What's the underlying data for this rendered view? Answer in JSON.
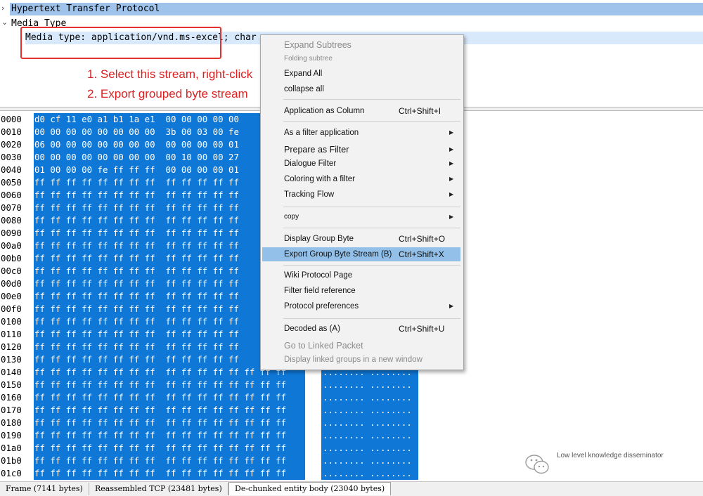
{
  "tree": {
    "http_row": "Hypertext Transfer Protocol",
    "media_row": "Media Type",
    "media_type_row": "Media type: application/vnd.ms-excel; char"
  },
  "annotations": {
    "step1": "1. Select this stream, right-click",
    "step2": "2. Export grouped byte stream"
  },
  "hex_rows": [
    {
      "offset": "0000",
      "bytes": "d0 cf 11 e0 a1 b1 1a e1  00 00 00 00 00",
      "ascii": ""
    },
    {
      "offset": "0010",
      "bytes": "00 00 00 00 00 00 00 00  3b 00 03 00 fe",
      "ascii": ""
    },
    {
      "offset": "0020",
      "bytes": "06 00 00 00 00 00 00 00  00 00 00 00 01",
      "ascii": ""
    },
    {
      "offset": "0030",
      "bytes": "00 00 00 00 00 00 00 00  00 10 00 00 27",
      "ascii": ""
    },
    {
      "offset": "0040",
      "bytes": "01 00 00 00 fe ff ff ff  00 00 00 00 01",
      "ascii": ""
    },
    {
      "offset": "0050",
      "bytes": "ff ff ff ff ff ff ff ff  ff ff ff ff ff",
      "ascii": ""
    },
    {
      "offset": "0060",
      "bytes": "ff ff ff ff ff ff ff ff  ff ff ff ff ff",
      "ascii": ""
    },
    {
      "offset": "0070",
      "bytes": "ff ff ff ff ff ff ff ff  ff ff ff ff ff",
      "ascii": ""
    },
    {
      "offset": "0080",
      "bytes": "ff ff ff ff ff ff ff ff  ff ff ff ff ff",
      "ascii": ""
    },
    {
      "offset": "0090",
      "bytes": "ff ff ff ff ff ff ff ff  ff ff ff ff ff",
      "ascii": ""
    },
    {
      "offset": "00a0",
      "bytes": "ff ff ff ff ff ff ff ff  ff ff ff ff ff",
      "ascii": ""
    },
    {
      "offset": "00b0",
      "bytes": "ff ff ff ff ff ff ff ff  ff ff ff ff ff",
      "ascii": ""
    },
    {
      "offset": "00c0",
      "bytes": "ff ff ff ff ff ff ff ff  ff ff ff ff ff",
      "ascii": ""
    },
    {
      "offset": "00d0",
      "bytes": "ff ff ff ff ff ff ff ff  ff ff ff ff ff",
      "ascii": ""
    },
    {
      "offset": "00e0",
      "bytes": "ff ff ff ff ff ff ff ff  ff ff ff ff ff",
      "ascii": ""
    },
    {
      "offset": "00f0",
      "bytes": "ff ff ff ff ff ff ff ff  ff ff ff ff ff",
      "ascii": ""
    },
    {
      "offset": "0100",
      "bytes": "ff ff ff ff ff ff ff ff  ff ff ff ff ff",
      "ascii": ""
    },
    {
      "offset": "0110",
      "bytes": "ff ff ff ff ff ff ff ff  ff ff ff ff ff",
      "ascii": ""
    },
    {
      "offset": "0120",
      "bytes": "ff ff ff ff ff ff ff ff  ff ff ff ff ff",
      "ascii": ""
    },
    {
      "offset": "0130",
      "bytes": "ff ff ff ff ff ff ff ff  ff ff ff ff ff",
      "ascii": ""
    },
    {
      "offset": "0140",
      "bytes": "ff ff ff ff ff ff ff ff  ff ff ff ff ff ff ff ff",
      "ascii": "........ ........"
    },
    {
      "offset": "0150",
      "bytes": "ff ff ff ff ff ff ff ff  ff ff ff ff ff ff ff ff",
      "ascii": "........ ........"
    },
    {
      "offset": "0160",
      "bytes": "ff ff ff ff ff ff ff ff  ff ff ff ff ff ff ff ff",
      "ascii": "........ ........"
    },
    {
      "offset": "0170",
      "bytes": "ff ff ff ff ff ff ff ff  ff ff ff ff ff ff ff ff",
      "ascii": "........ ........"
    },
    {
      "offset": "0180",
      "bytes": "ff ff ff ff ff ff ff ff  ff ff ff ff ff ff ff ff",
      "ascii": "........ ........"
    },
    {
      "offset": "0190",
      "bytes": "ff ff ff ff ff ff ff ff  ff ff ff ff ff ff ff ff",
      "ascii": "........ ........"
    },
    {
      "offset": "01a0",
      "bytes": "ff ff ff ff ff ff ff ff  ff ff ff ff ff ff ff ff",
      "ascii": "........ ........"
    },
    {
      "offset": "01b0",
      "bytes": "ff ff ff ff ff ff ff ff  ff ff ff ff ff ff ff ff",
      "ascii": "........ ........"
    },
    {
      "offset": "01c0",
      "bytes": "ff ff ff ff ff ff ff ff  ff ff ff ff ff ff ff ff",
      "ascii": "........ ........"
    }
  ],
  "tabs": [
    "Frame (7141 bytes)",
    "Reassembled TCP (23481 bytes)",
    "De-chunked entity body (23040 bytes)"
  ],
  "context_menu": {
    "expand_subtrees": "Expand Subtrees",
    "folding_subtree": "Folding subtree",
    "expand_all": "Expand All",
    "collapse_all": "collapse all",
    "apply_as_column": "Application as Column",
    "apply_as_column_shortcut": "Ctrl+Shift+I",
    "as_filter_app": "As a filter application",
    "prepare_filter": "Prepare as Filter",
    "dialogue_filter": "Dialogue Filter",
    "coloring_filter": "Coloring with a filter",
    "tracking_flow": "Tracking Flow",
    "copy": "copy",
    "display_group_byte": "Display Group Byte",
    "display_group_byte_shortcut": "Ctrl+Shift+O",
    "export_group_byte": "Export Group Byte Stream (B)",
    "export_group_byte_shortcut": "Ctrl+Shift+X",
    "wiki_protocol": "Wiki Protocol Page",
    "filter_field_ref": "Filter field reference",
    "protocol_prefs": "Protocol preferences",
    "decoded_as": "Decoded as (A)",
    "decoded_as_shortcut": "Ctrl+Shift+U",
    "goto_linked": "Go to Linked Packet",
    "display_linked": "Display linked groups in a new window"
  },
  "watermark": "Low level knowledge disseminator"
}
